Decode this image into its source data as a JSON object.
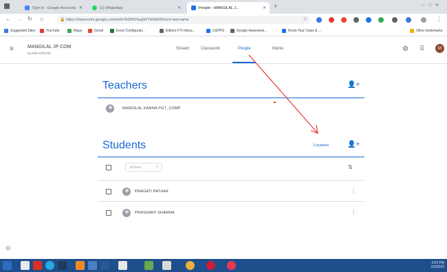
{
  "browser": {
    "tabs": [
      {
        "label": "Sign in - Google Accounts",
        "active": false,
        "color": "#4285f4"
      },
      {
        "label": "(1) WhatsApp",
        "active": false,
        "color": "#25d366"
      },
      {
        "label": "People - MANGILAL J...",
        "active": true,
        "color": "#1a73e8"
      }
    ],
    "new_tab": "+",
    "window_controls": "— □ ✕",
    "url": "https://classroom.google.com/u/0/r/NDM1Nzg0OTk0NDA5/sort-last-name",
    "bookmarks": [
      {
        "label": "Suggested Sites",
        "color": "#3c78d8"
      },
      {
        "label": "YouTube",
        "color": "#e53935"
      },
      {
        "label": "Maps",
        "color": "#34a853"
      },
      {
        "label": "Gmail",
        "color": "#ea4335"
      },
      {
        "label": "Excel Configurati...",
        "color": "#1e7e34"
      },
      {
        "label": "Editors FYI Inbou...",
        "color": "#5f6368"
      },
      {
        "label": "GSPPS",
        "color": "#1a73e8"
      },
      {
        "label": "Google Assessme...",
        "color": "#5f6368"
      },
      {
        "label": "Know Your Class & ...",
        "color": "#1a73e8"
      }
    ],
    "other_bookmarks": "Other bookmarks"
  },
  "classroom": {
    "class_name": "MANGILAL JP COM",
    "class_section": "CLASS 12TH XII",
    "nav_tabs": [
      "Stream",
      "Classwork",
      "People",
      "Marks"
    ],
    "active_tab": "People",
    "avatar_initial": "M"
  },
  "teachers": {
    "title": "Teachers",
    "list": [
      "MANGILAL KARNA PGT_COMP"
    ]
  },
  "students": {
    "title": "Students",
    "count_label": "2 students",
    "actions_label": "Actions",
    "list": [
      "PRAGATI PATHAK",
      "PRASHANT SHARMA"
    ]
  },
  "taskbar": {
    "time": "4:02 PM",
    "date": "3/3/2023"
  },
  "colors": {
    "accent": "#1967d2",
    "arrow": "#e53935",
    "taskbar": "#1f4e8c"
  }
}
